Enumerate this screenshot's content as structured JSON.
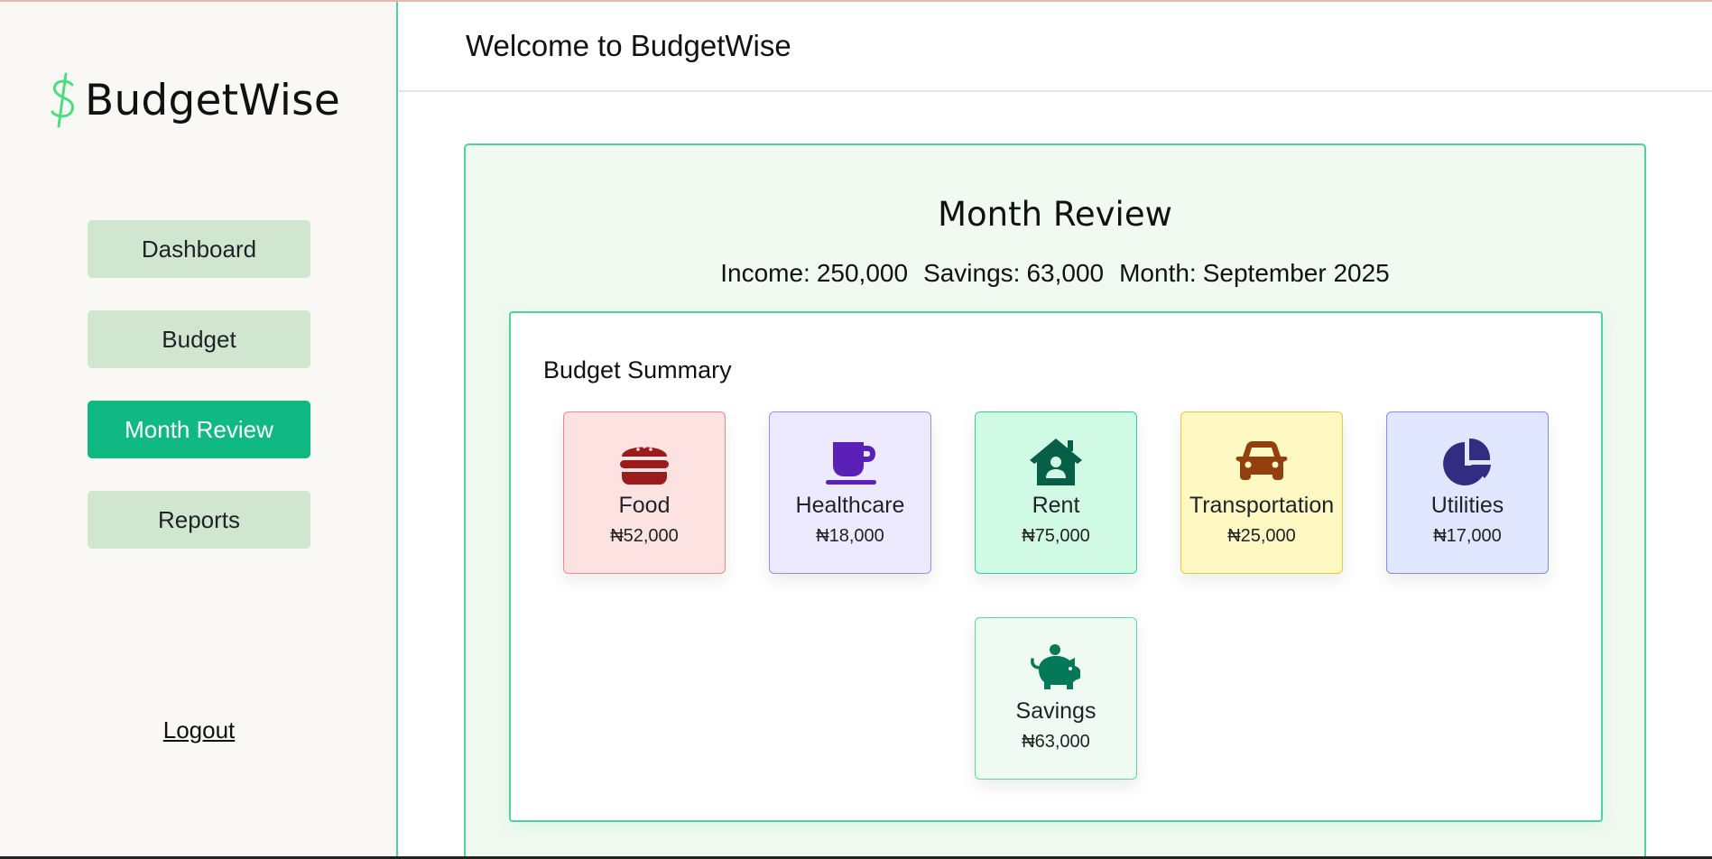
{
  "sidebar": {
    "brand": "BudgetWise",
    "brand_icon": "dollar-sign-icon",
    "nav": [
      {
        "label": "Dashboard",
        "active": false
      },
      {
        "label": "Budget",
        "active": false
      },
      {
        "label": "Month Review",
        "active": true
      },
      {
        "label": "Reports",
        "active": false
      }
    ],
    "logout": "Logout"
  },
  "header": {
    "welcome": "Welcome to BudgetWise"
  },
  "review": {
    "title": "Month Review",
    "income_label": "Income:",
    "income_value": "250,000",
    "savings_label": "Savings:",
    "savings_value": "63,000",
    "month_label": "Month:",
    "month_value": "September 2025",
    "summary_title": "Budget Summary",
    "categories": [
      {
        "label": "Food",
        "amount": "₦52,000",
        "icon": "burger-icon",
        "color": "#9b1c1c"
      },
      {
        "label": "Healthcare",
        "amount": "₦18,000",
        "icon": "mug-icon",
        "color": "#5b21b6"
      },
      {
        "label": "Rent",
        "amount": "₦75,000",
        "icon": "house-user-icon",
        "color": "#065f46"
      },
      {
        "label": "Transportation",
        "amount": "₦25,000",
        "icon": "car-icon",
        "color": "#92400e"
      },
      {
        "label": "Utilities",
        "amount": "₦17,000",
        "icon": "pie-chart-icon",
        "color": "#312e81"
      },
      {
        "label": "Savings",
        "amount": "₦63,000",
        "icon": "piggy-bank-icon",
        "color": "#047857"
      }
    ]
  },
  "colors": {
    "accent": "#10b981",
    "nav_bg": "#d0e6cf",
    "border": "#4fd1a0",
    "panel_bg": "#f1faf1"
  }
}
